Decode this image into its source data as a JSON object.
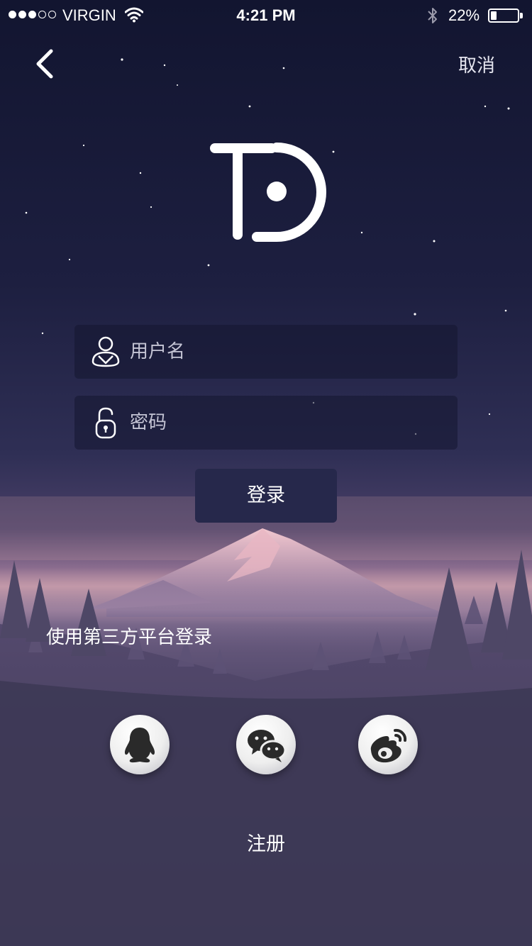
{
  "status_bar": {
    "carrier": "VIRGIN",
    "time": "4:21 PM",
    "battery_text": "22%",
    "battery_level": 0.22,
    "signal_bars_filled": 3,
    "signal_bars_total": 5
  },
  "nav": {
    "cancel_label": "取消"
  },
  "form": {
    "username_placeholder": "用户名",
    "password_placeholder": "密码",
    "login_label": "登录"
  },
  "third_party": {
    "label": "使用第三方平台登录",
    "providers": [
      {
        "icon": "qq-penguin-icon"
      },
      {
        "icon": "wechat-icon"
      },
      {
        "icon": "weibo-icon"
      }
    ]
  },
  "footer": {
    "register_label": "注册"
  },
  "colors": {
    "login_button": "#26284b",
    "input_background": "#141630",
    "sky_top": "#121530",
    "horizon_glow": "#c99aa6"
  }
}
